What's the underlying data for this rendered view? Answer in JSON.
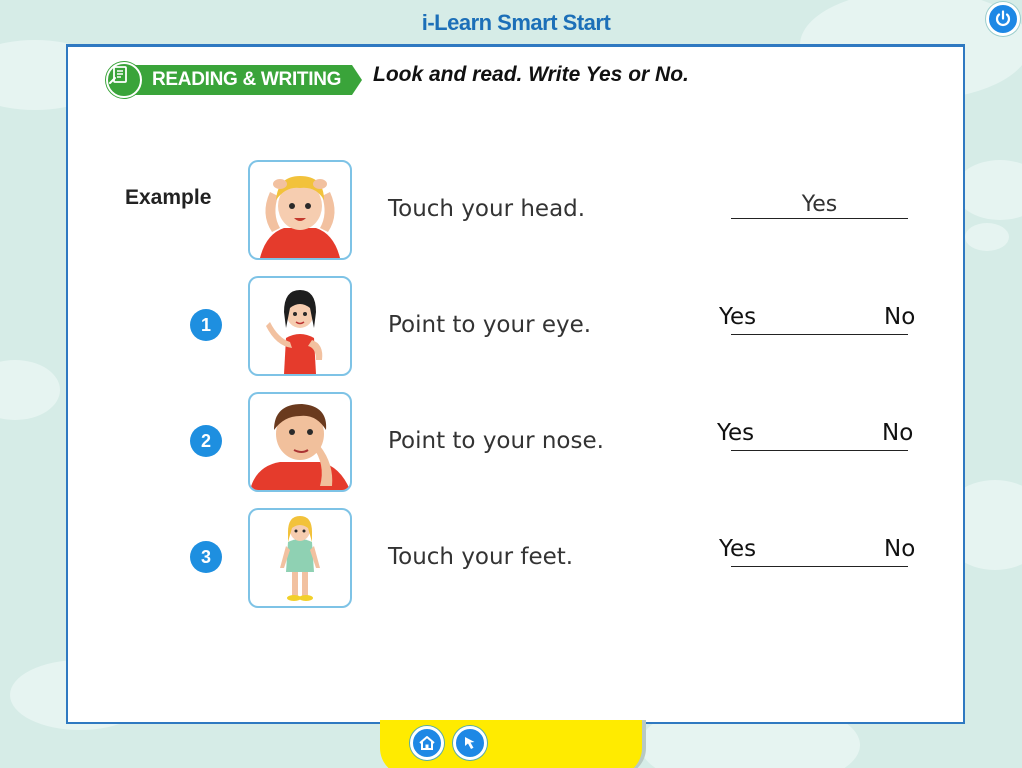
{
  "app_title": "i-Learn Smart Start",
  "icons": {
    "power": "power-icon",
    "section": "reading-writing-icon",
    "home": "home-icon",
    "back": "back-arrow-icon"
  },
  "colors": {
    "title_blue": "#1c6fb8",
    "badge_green": "#3aa43a",
    "number_blue": "#1e8fe0",
    "footer_yellow": "#ffeb00",
    "background": "#d6ece7"
  },
  "section": {
    "label": "READING & WRITING",
    "instruction": "Look and read. Write Yes or No."
  },
  "example": {
    "label": "Example",
    "sentence": "Touch your head.",
    "answer": "Yes",
    "image": "boy-touching-head"
  },
  "items": [
    {
      "number": "1",
      "sentence": "Point to your eye.",
      "image": "girl-pointing-elbow",
      "option_yes": "Yes",
      "option_no": "No"
    },
    {
      "number": "2",
      "sentence": "Point to your nose.",
      "image": "boy-pointing-nose",
      "option_yes": "Yes",
      "option_no": "No"
    },
    {
      "number": "3",
      "sentence": "Touch your feet.",
      "image": "girl-standing",
      "option_yes": "Yes",
      "option_no": "No"
    }
  ]
}
